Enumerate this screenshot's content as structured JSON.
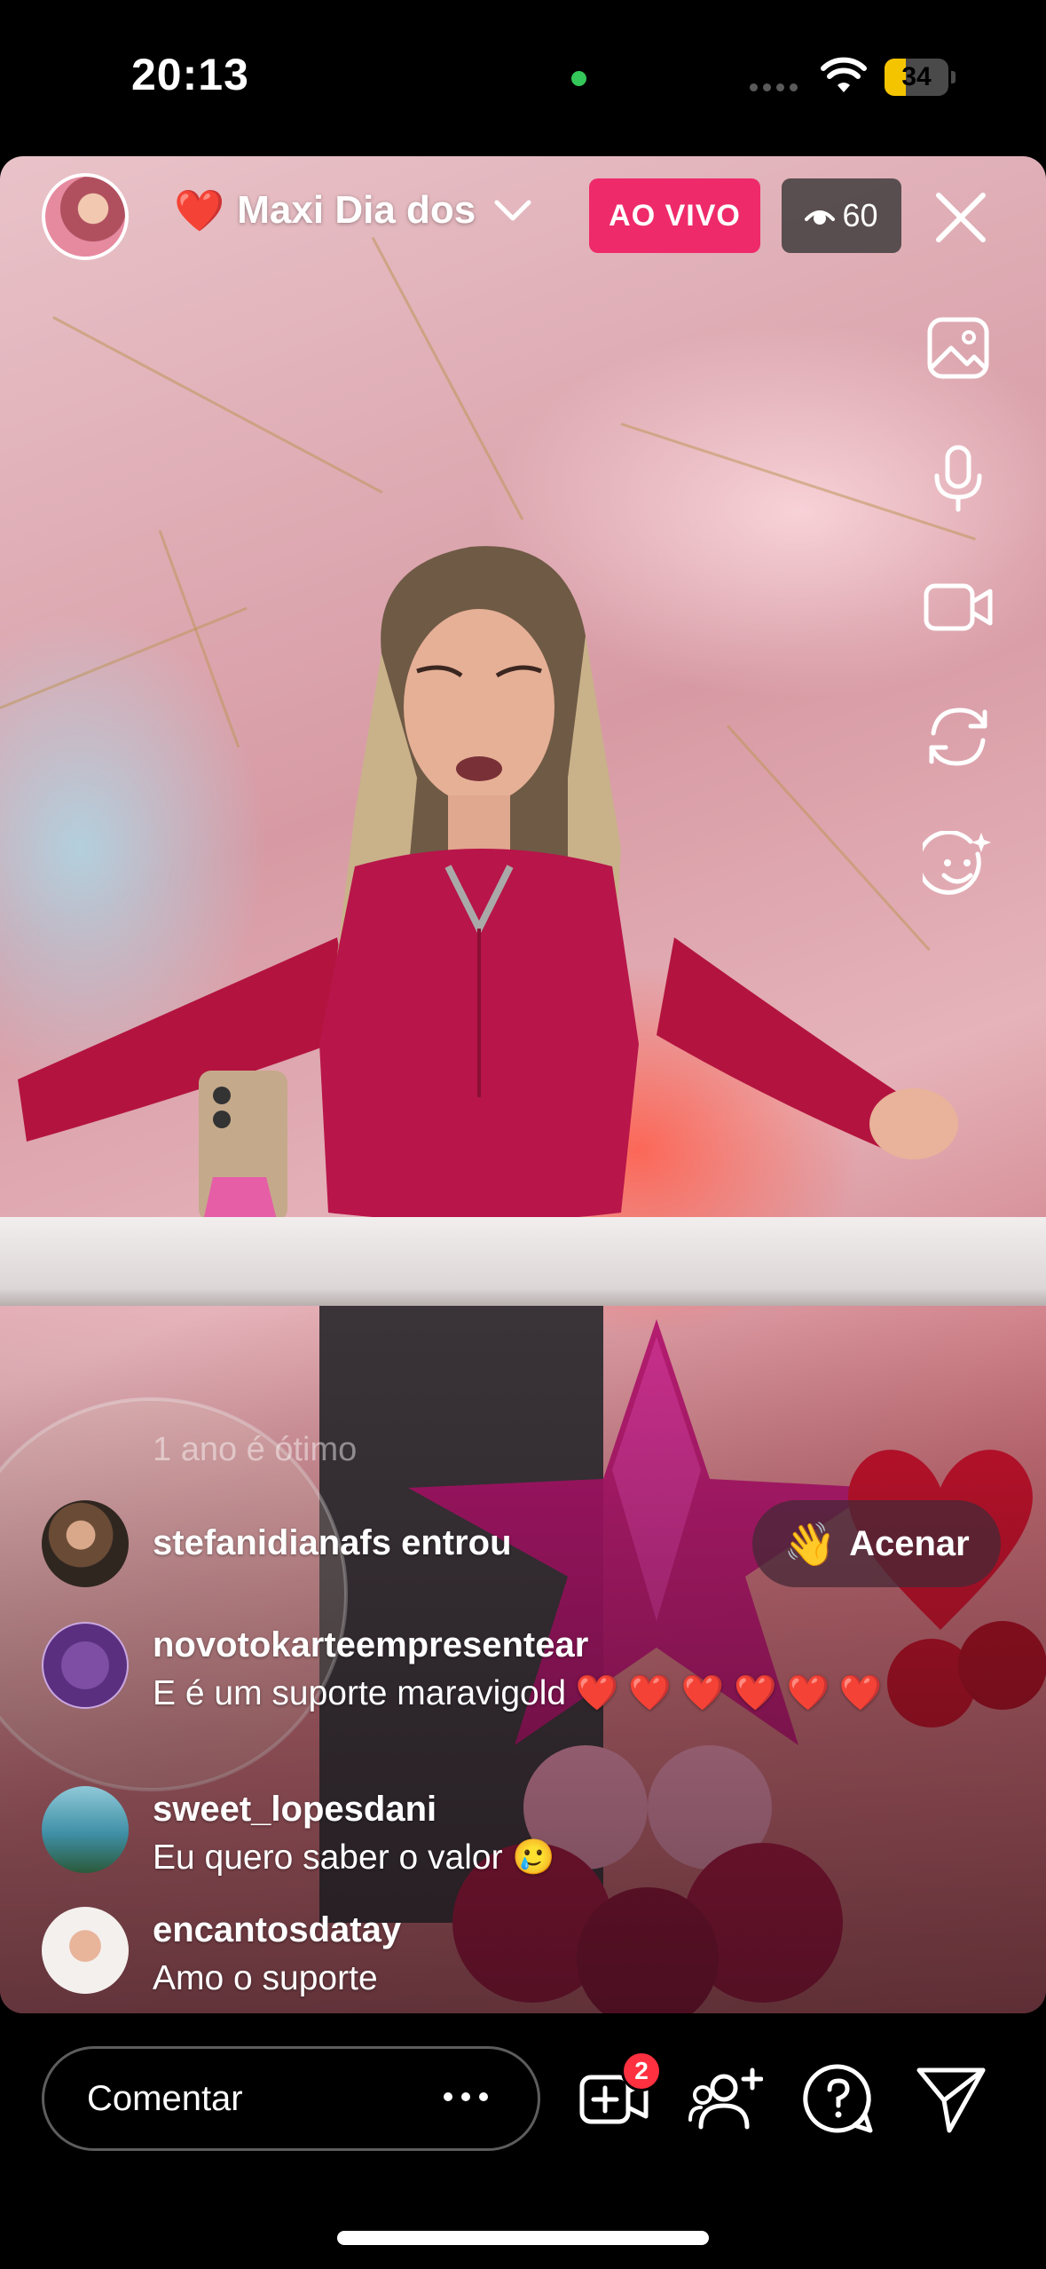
{
  "status_bar": {
    "time": "20:13",
    "battery": "34",
    "battery_level": 0.34
  },
  "live": {
    "title": "Maxi Dia dos",
    "title_emoji": "❤️",
    "live_label": "AO VIVO",
    "viewer_count": "60"
  },
  "chat": {
    "faded_comment": "1 ano é ótimo",
    "join_event": {
      "user": "stefanidianafs entrou",
      "wave_label": "Acenar",
      "wave_emoji": "👋"
    },
    "comments": [
      {
        "user": "novotokarteempresentear",
        "message": "E é um suporte maravigold ❤️ ❤️ ❤️ ❤️ ❤️ ❤️"
      },
      {
        "user": "sweet_lopesdani",
        "message": "Eu quero saber o valor 🥲"
      },
      {
        "user": "encantosdatay",
        "message": "Amo o suporte"
      }
    ]
  },
  "bottom_bar": {
    "comment_placeholder": "Comentar",
    "requests_badge": "2"
  },
  "icons": {
    "side": [
      "gallery-icon",
      "microphone-icon",
      "video-camera-icon",
      "flip-camera-icon",
      "effects-face-icon"
    ],
    "bottom": [
      "add-guest-video-icon",
      "invite-people-icon",
      "question-icon",
      "share-send-icon"
    ]
  },
  "colors": {
    "live_badge": "#ee2a6b",
    "notification_badge": "#ff3040",
    "battery_fill": "#f5c400"
  }
}
